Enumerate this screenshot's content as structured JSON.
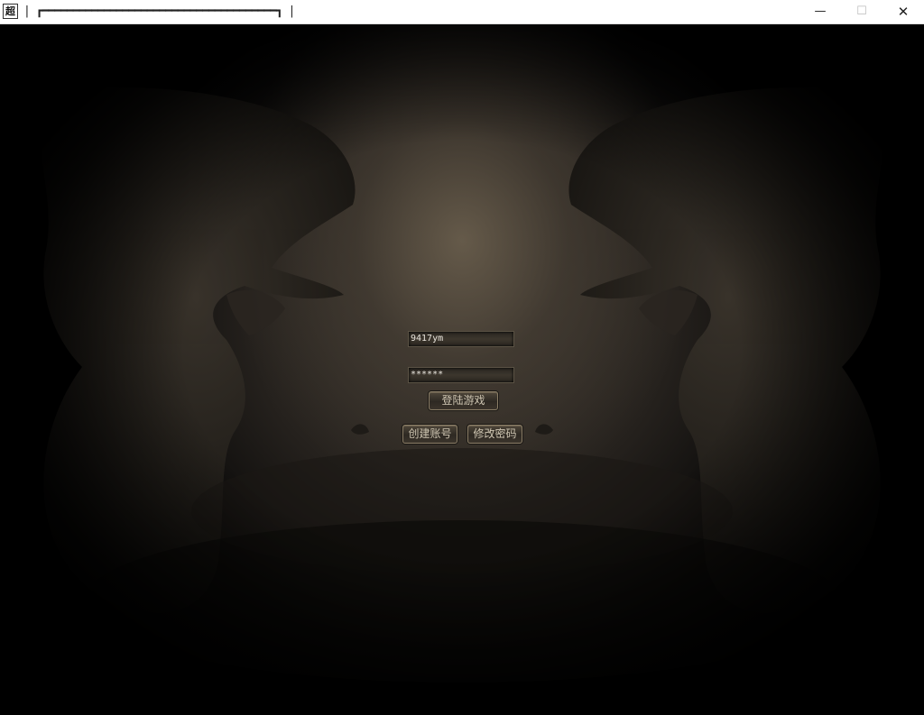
{
  "window": {
    "title": "┏━━━━━━━━━━━━━━━━━━━━━━━━━━━━━━━━━━━━━━┓",
    "icon_glyph": "超",
    "controls": {
      "minimize": "—",
      "maximize": "☐",
      "close": "✕"
    }
  },
  "login": {
    "username_value": "9417ym",
    "password_value": "******",
    "login_button": "登陆游戏",
    "create_account_button": "创建账号",
    "change_password_button": "修改密码"
  },
  "colors": {
    "background": "#000000",
    "panel_center": "#6e6250",
    "button_text": "#cfc6b2",
    "field_text": "#e8e4dc"
  }
}
